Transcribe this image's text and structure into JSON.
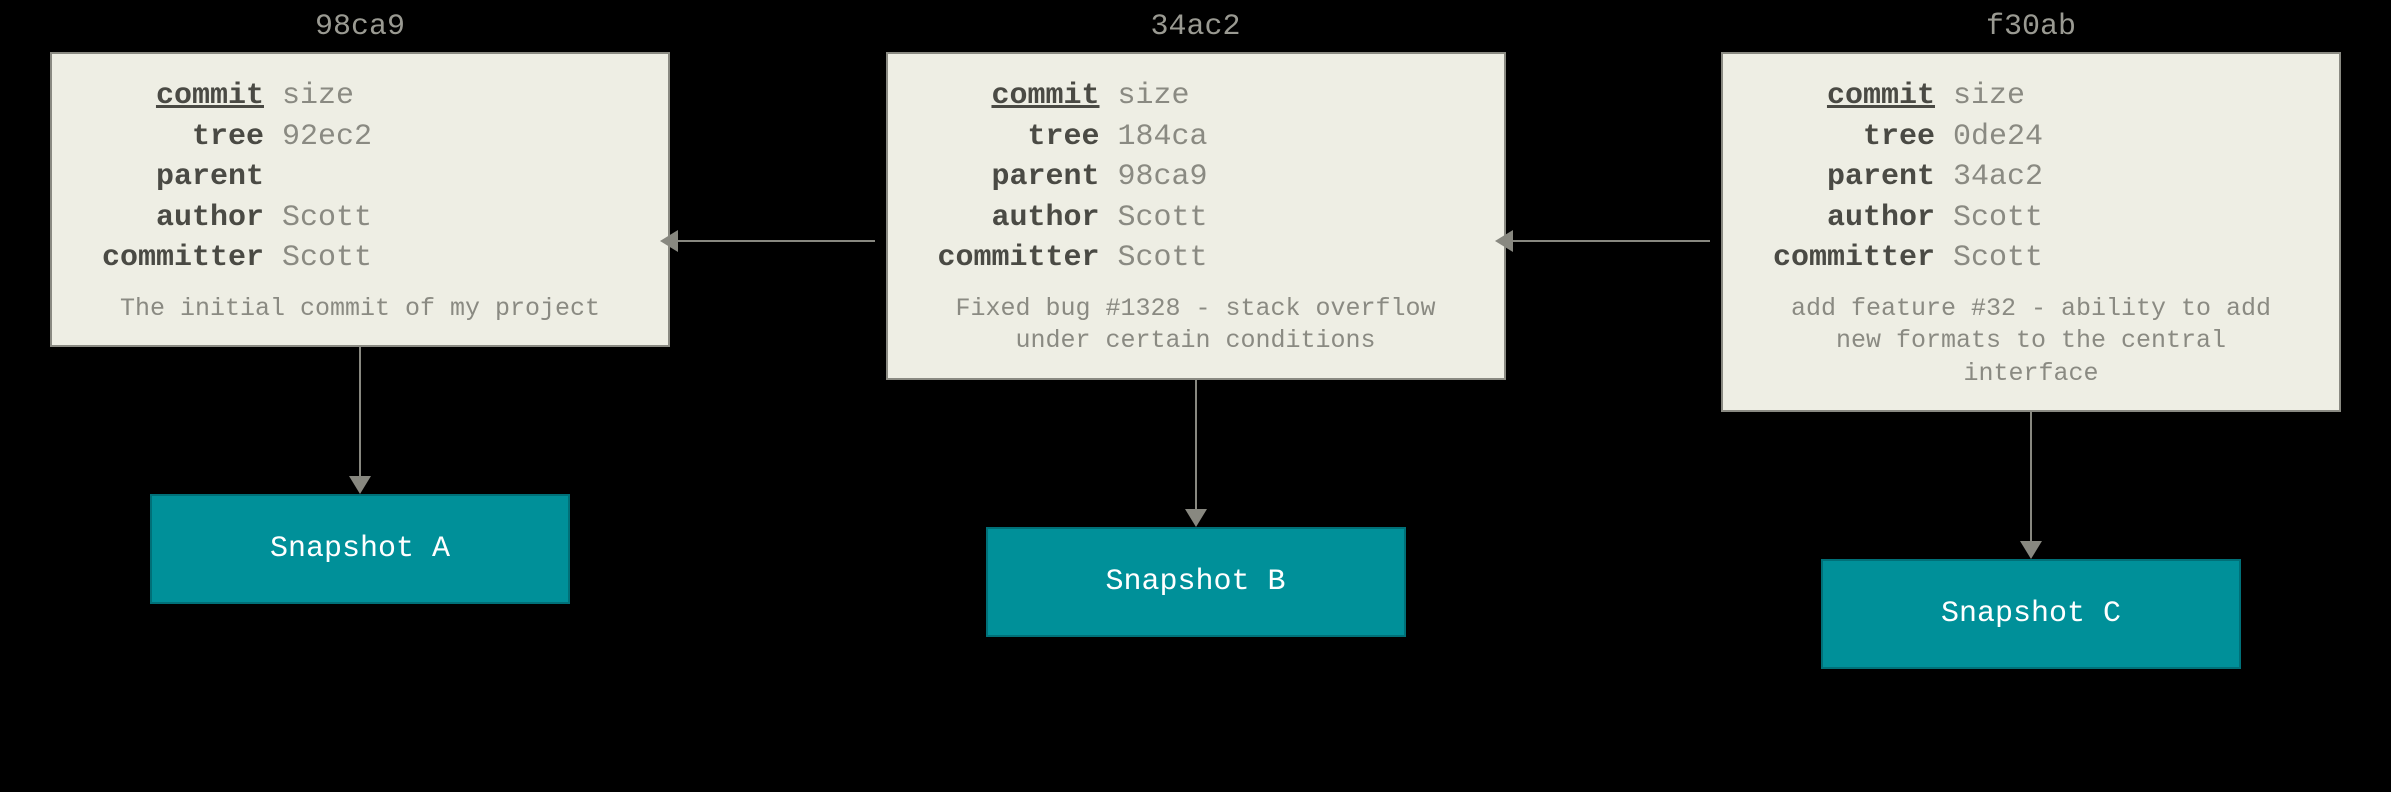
{
  "commits": [
    {
      "hash": "98ca9",
      "fields": {
        "commit": "size",
        "tree": "92ec2",
        "parent": "",
        "author": "Scott",
        "committer": "Scott"
      },
      "message": "The initial commit of my project",
      "snapshot": "Snapshot A"
    },
    {
      "hash": "34ac2",
      "fields": {
        "commit": "size",
        "tree": "184ca",
        "parent": "98ca9",
        "author": "Scott",
        "committer": "Scott"
      },
      "message": "Fixed bug #1328 - stack overflow under certain conditions",
      "snapshot": "Snapshot B"
    },
    {
      "hash": "f30ab",
      "fields": {
        "commit": "size",
        "tree": "0de24",
        "parent": "34ac2",
        "author": "Scott",
        "committer": "Scott"
      },
      "message": "add feature #32 - ability to add new formats to the central interface",
      "snapshot": "Snapshot C"
    }
  ],
  "labels": {
    "commit": "commit",
    "tree": "tree",
    "parent": "parent",
    "author": "author",
    "committer": "committer"
  }
}
